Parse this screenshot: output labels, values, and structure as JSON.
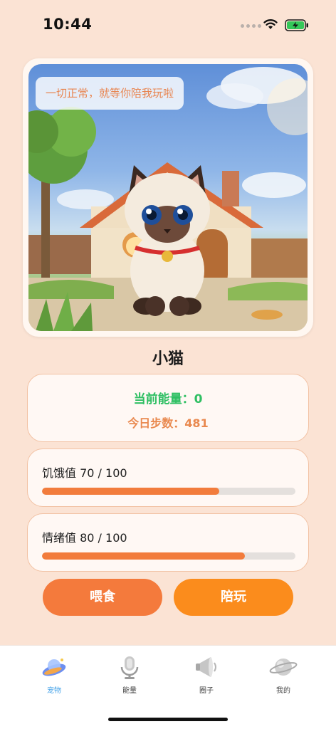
{
  "status_bar": {
    "time": "10:44"
  },
  "pet": {
    "speech": "一切正常，就等你陪我玩啦",
    "name": "小猫"
  },
  "stats": {
    "energy_text": "当前能量：0",
    "steps_text": "今日步数：481"
  },
  "meters": [
    {
      "label": "饥饿值 70 / 100",
      "value": 70,
      "max": 100
    },
    {
      "label": "情绪值 80 / 100",
      "value": 80,
      "max": 100
    }
  ],
  "actions": {
    "feed_label": "喂食",
    "play_label": "陪玩"
  },
  "tabs": [
    {
      "label": "宠物",
      "icon": "ufo-icon",
      "active": true
    },
    {
      "label": "能量",
      "icon": "microphone-icon",
      "active": false
    },
    {
      "label": "圈子",
      "icon": "megaphone-icon",
      "active": false
    },
    {
      "label": "我的",
      "icon": "planet-icon",
      "active": false
    }
  ],
  "colors": {
    "background": "#fbe3d4",
    "energy": "#2fbf63",
    "steps": "#e9894f",
    "meter_fill": "#f27c3c",
    "feed_button": "#f47a3c",
    "play_button": "#fb8c1c",
    "active_tab": "#3fa0e8"
  }
}
